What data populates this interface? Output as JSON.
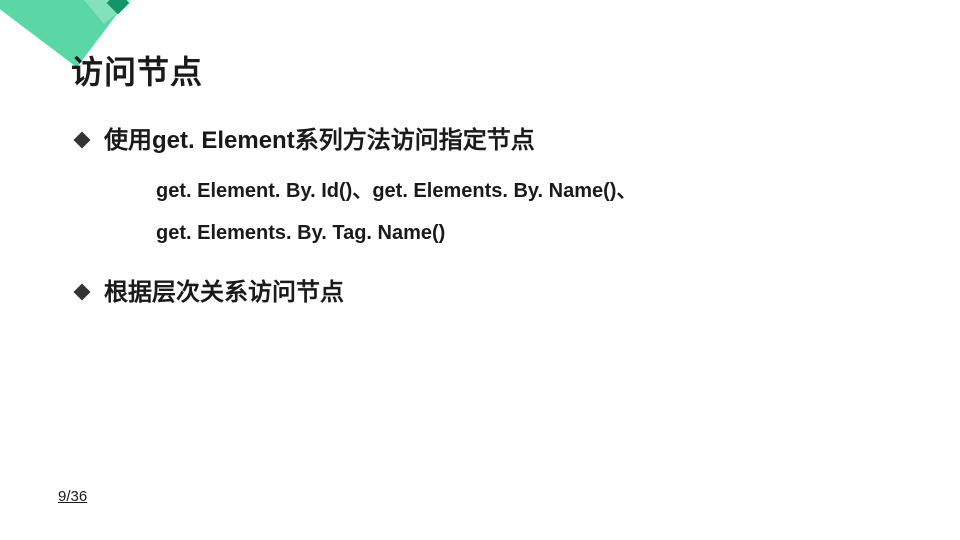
{
  "slide": {
    "title": "访问节点",
    "bullets": {
      "b1": "使用get. Element系列方法访问指定节点",
      "b1_sub_line1": "get. Element. By. Id()、get. Elements. By. Name()、",
      "b1_sub_line2": "get. Elements. By. Tag. Name()",
      "b2": "根据层次关系访问节点"
    },
    "page": "9/36"
  }
}
